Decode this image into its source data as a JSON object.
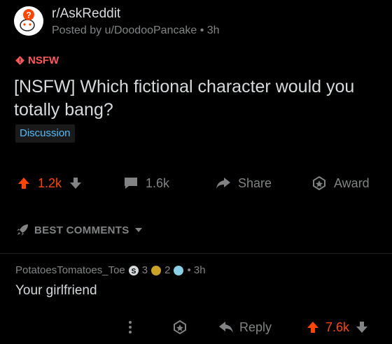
{
  "post": {
    "subreddit": "r/AskReddit",
    "posted_by": "Posted by u/DoodooPancake • 3h",
    "nsfw_label": "NSFW",
    "title": "[NSFW] Which fictional character would you totally bang?",
    "flair": "Discussion",
    "upvotes": "1.2k",
    "comments": "1.6k",
    "share_label": "Share",
    "award_label": "Award"
  },
  "sort": {
    "label": "BEST COMMENTS"
  },
  "comment": {
    "author": "PotatoesTomatoes_Toe",
    "award_silver_count": "3",
    "award_gold_count": "2",
    "time": "• 3h",
    "body": "Your girlfriend",
    "reply_label": "Reply",
    "upvotes": "7.6k"
  },
  "colors": {
    "upvote": "#ff4500",
    "nsfw": "#ff585b",
    "flair_text": "#4fbcff",
    "muted": "#818384",
    "text": "#d7dadc",
    "background": "#000000"
  }
}
